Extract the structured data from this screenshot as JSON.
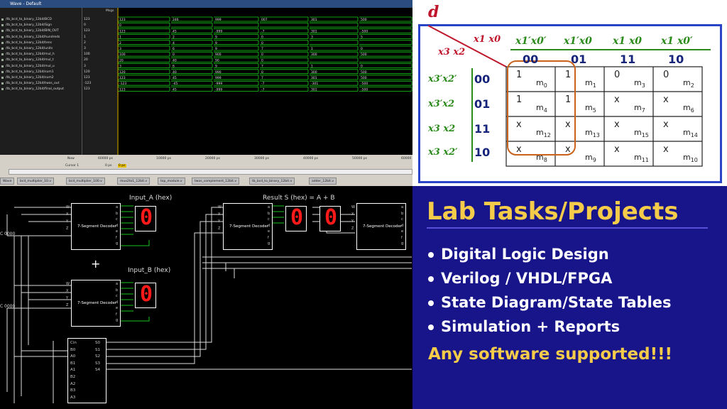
{
  "wave": {
    "title": "Wave - Default",
    "msgs_label": "Msgs",
    "signals": [
      {
        "name": "/tb_bcd_to_binary_12bit/BCD",
        "value": "123"
      },
      {
        "name": "/tb_bcd_to_binary_12bit/Sign",
        "value": "0"
      },
      {
        "name": "/tb_bcd_to_binary_12bit/BIN_OUT",
        "value": "123"
      },
      {
        "name": "/tb_bcd_to_binary_12bit/hundreds",
        "value": "1"
      },
      {
        "name": "/tb_bcd_to_binary_12bit/tens",
        "value": "2"
      },
      {
        "name": "/tb_bcd_to_binary_12bit/units",
        "value": "3"
      },
      {
        "name": "/tb_bcd_to_binary_12bit/mul_h",
        "value": "100"
      },
      {
        "name": "/tb_bcd_to_binary_12bit/mul_t",
        "value": "20"
      },
      {
        "name": "/tb_bcd_to_binary_12bit/mul_u",
        "value": "3"
      },
      {
        "name": "/tb_bcd_to_binary_12bit/sum1",
        "value": "120"
      },
      {
        "name": "/tb_bcd_to_binary_12bit/sum2",
        "value": "123"
      },
      {
        "name": "/tb_bcd_to_binary_12bit/twos_out",
        "value": "-123"
      },
      {
        "name": "/tb_bcd_to_binary_12bit/final_output",
        "value": "123"
      }
    ],
    "segments": [
      [
        "123",
        "246",
        "999",
        "007",
        "301",
        "500"
      ],
      [
        "0",
        "",
        "",
        "",
        "",
        ""
      ],
      [
        "123",
        "45",
        "-999",
        "-7",
        "301",
        "-500"
      ],
      [
        "1",
        "2",
        "9",
        "0",
        "3",
        "5"
      ],
      [
        "2",
        "4",
        "9",
        "0",
        "",
        ""
      ],
      [
        "3",
        "6",
        "9",
        "7",
        "1",
        "0"
      ],
      [
        "100",
        "0",
        "900",
        "0",
        "300",
        "500"
      ],
      [
        "20",
        "40",
        "90",
        "0",
        "",
        ""
      ],
      [
        "3",
        "6",
        "9",
        "7",
        "1",
        "0"
      ],
      [
        "120",
        "40",
        "990",
        "0",
        "300",
        "500"
      ],
      [
        "123",
        "45",
        "999",
        "7",
        "301",
        "500"
      ],
      [
        "-123",
        "-45",
        "-999",
        "-7",
        "-301",
        "-500"
      ],
      [
        "123",
        "45",
        "-999",
        "-7",
        "301",
        "-500"
      ]
    ],
    "now_label": "Now",
    "now_value": "60000 ps",
    "cursor_label": "Cursor 1",
    "cursor_value": "0 ps",
    "cursor_marker": "0 ps",
    "time_ticks": [
      "10000 ps",
      "20000 ps",
      "30000 ps",
      "40000 ps",
      "50000 ps",
      "60000"
    ],
    "tabs": [
      "Wave",
      "bcd_multiplier_10.v",
      "bcd_multiplier_100.v",
      "mux2to1_12bit.v",
      "top_module.v",
      "twos_complement_12bit.v",
      "tb_bcd_to_binary_12bit.v",
      "adder_12bit.v"
    ]
  },
  "kmap": {
    "func": "d",
    "row_var": "x3 x2",
    "col_var": "x1 x0",
    "col_headers": [
      {
        "label": "x1′x0′",
        "code": "00"
      },
      {
        "label": "x1′x0",
        "code": "01"
      },
      {
        "label": "x1 x0",
        "code": "11"
      },
      {
        "label": "x1 x0′",
        "code": "10"
      }
    ],
    "row_headers": [
      {
        "label": "x3′x2′",
        "code": "00"
      },
      {
        "label": "x3′x2",
        "code": "01"
      },
      {
        "label": "x3 x2",
        "code": "11"
      },
      {
        "label": "x3 x2′",
        "code": "10"
      }
    ],
    "cells": [
      [
        {
          "v": "1",
          "m": "0"
        },
        {
          "v": "1",
          "m": "1"
        },
        {
          "v": "0",
          "m": "3"
        },
        {
          "v": "0",
          "m": "2"
        }
      ],
      [
        {
          "v": "1",
          "m": "4"
        },
        {
          "v": "1",
          "m": "5"
        },
        {
          "v": "x",
          "m": "7"
        },
        {
          "v": "x",
          "m": "6"
        }
      ],
      [
        {
          "v": "x",
          "m": "12"
        },
        {
          "v": "x",
          "m": "13"
        },
        {
          "v": "x",
          "m": "15"
        },
        {
          "v": "x",
          "m": "14"
        }
      ],
      [
        {
          "v": "x",
          "m": "8"
        },
        {
          "v": "x",
          "m": "9"
        },
        {
          "v": "x",
          "m": "11"
        },
        {
          "v": "x",
          "m": "10"
        }
      ]
    ],
    "m_prefix": "m",
    "colors": {
      "frame": "#2a44c8",
      "header": "#2a8a1a",
      "group": "#c8621c",
      "func": "#c0162c"
    }
  },
  "circuit": {
    "input_a_label": "Input_A (hex)",
    "input_b_label": "Input_B (hex)",
    "result_label": "Result S (hex) = A + B",
    "plus": "+",
    "decoder_name": "7-Segment Decoder",
    "decoder_inputs": [
      "W",
      "X",
      "Y",
      "Z"
    ],
    "decoder_outputs": [
      "a",
      "b",
      "c",
      "d",
      "e",
      "f",
      "g"
    ],
    "digit": "0",
    "adder_inputs": [
      "Cin",
      "B0",
      "A0",
      "B1",
      "A1",
      "B2",
      "A2",
      "B3",
      "A3"
    ],
    "adder_outputs": [
      "S0",
      "S1",
      "S2",
      "S3",
      "S4"
    ],
    "switch_label": "0000",
    "switch_tag": "C",
    "segment_color": "#ff1a1a",
    "wire_on_color": "#19c419"
  },
  "promo": {
    "title": "Lab Tasks/Projects",
    "bullets": [
      "Digital Logic Design",
      "Verilog / VHDL/FPGA",
      "State Diagram/State Tables",
      "Simulation + Reports"
    ],
    "footer": "Any software supported!!!",
    "colors": {
      "bg": "#18148a",
      "accent": "#f5cc4a"
    }
  }
}
